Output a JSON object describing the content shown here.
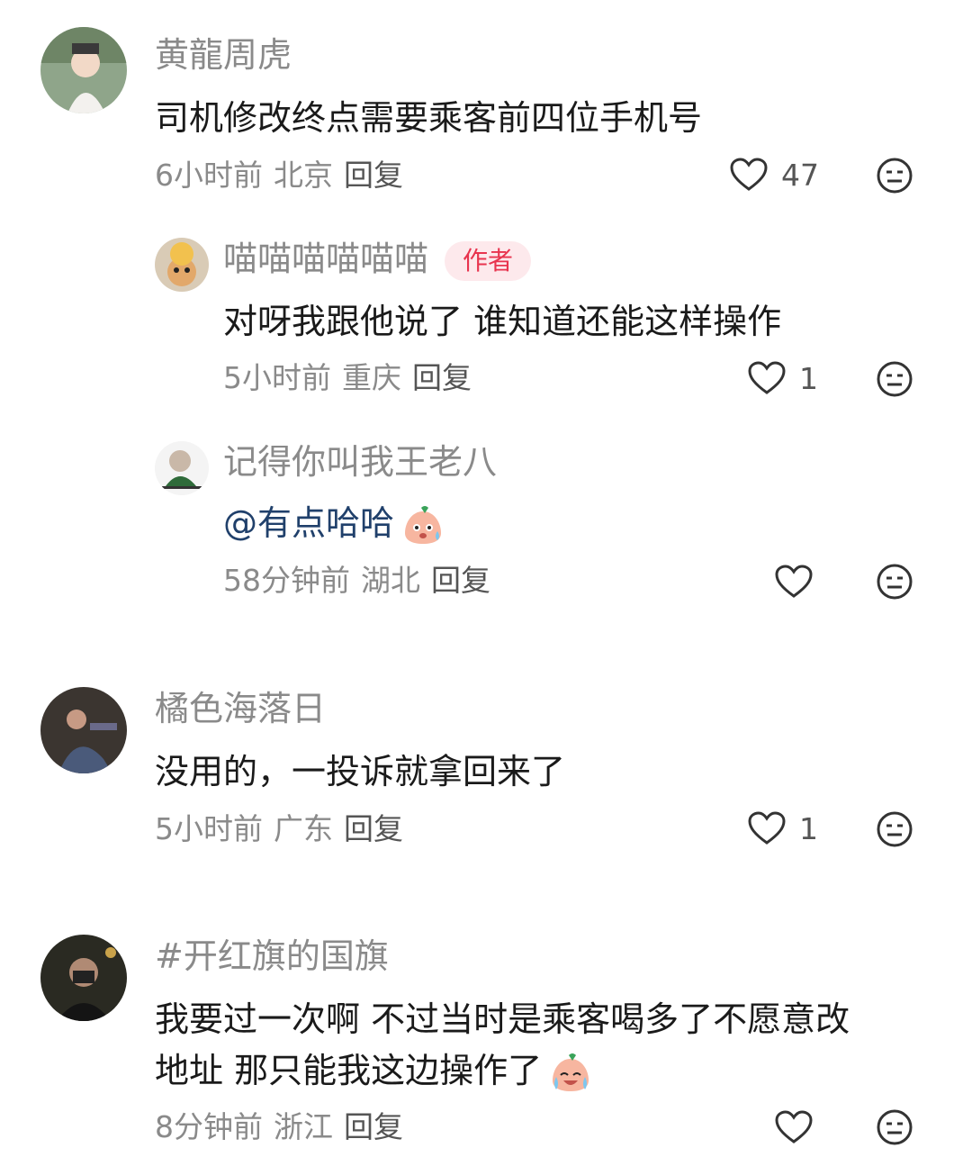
{
  "comments": [
    {
      "username": "黄龍周虎",
      "text": "司机修改终点需要乘客前四位手机号",
      "time": "6小时前",
      "location": "北京",
      "reply": "回复",
      "likes": "47"
    },
    {
      "username": "喵喵喵喵喵喵",
      "badge": "作者",
      "text": "对呀我跟他说了 谁知道还能这样操作",
      "time": "5小时前",
      "location": "重庆",
      "reply": "回复",
      "likes": "1"
    },
    {
      "username": "记得你叫我王老八",
      "mention": "@有点哈哈",
      "emoji": "sweat-blob-emoji",
      "time": "58分钟前",
      "location": "湖北",
      "reply": "回复"
    },
    {
      "username": "橘色海落日",
      "text": "没用的，一投诉就拿回来了",
      "time": "5小时前",
      "location": "广东",
      "reply": "回复",
      "likes": "1"
    },
    {
      "username": "#开红旗的国旗",
      "text_line1": "我要过一次啊 不过当时是乘客喝多了不愿意改",
      "text_line2": "地址 那只能我这边操作了",
      "emoji": "crying-laugh-blob-emoji",
      "time": "8分钟前",
      "location": "浙江",
      "reply": "回复"
    }
  ],
  "colors": {
    "username": "#8a8a8a",
    "text": "#1a1a1a",
    "badge_bg": "#fde9ec",
    "badge_text": "#e8344e",
    "mention": "#20406b"
  }
}
